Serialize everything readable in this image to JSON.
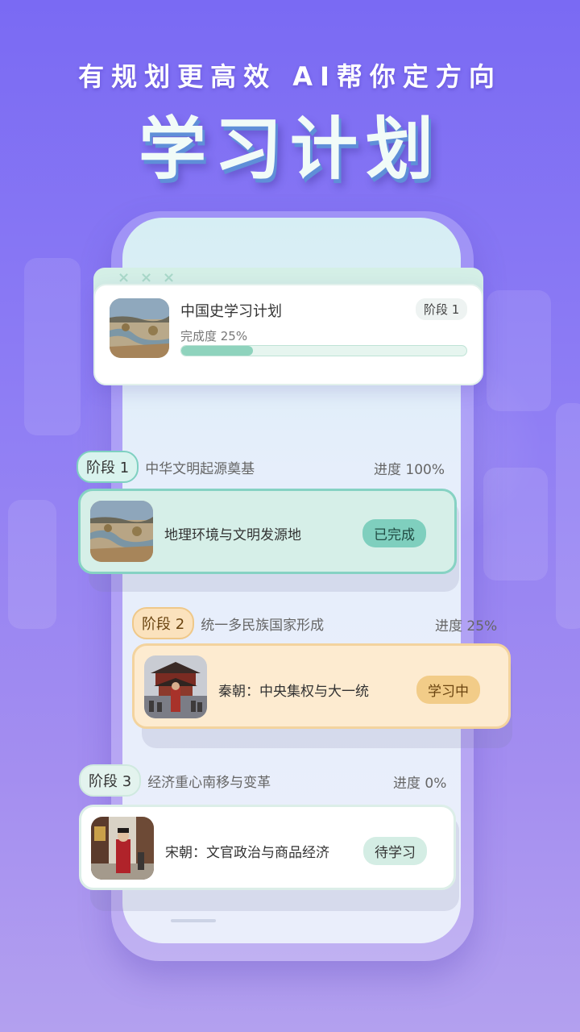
{
  "promo": {
    "tagline": "有规划更高效  AI帮你定方向",
    "headline": "学习计划"
  },
  "plan_card": {
    "title": "中国史学习计划",
    "stage_badge": "阶段 1",
    "progress_label": "完成度 25%",
    "progress": 0.25,
    "close_marks": [
      "×",
      "×",
      "×"
    ]
  },
  "stages": [
    {
      "badge": "阶段 1",
      "title": "中华文明起源奠基",
      "progress": "进度 100%",
      "lesson": {
        "title": "地理环境与文明发源地",
        "status": "已完成"
      }
    },
    {
      "badge": "阶段 2",
      "title": "统一多民族国家形成",
      "progress": "进度 25%",
      "lesson": {
        "title": "秦朝：中央集权与大一统",
        "status": "学习中"
      }
    },
    {
      "badge": "阶段 3",
      "title": "经济重心南移与变革",
      "progress": "进度 0%",
      "lesson": {
        "title": "宋朝：文官政治与商品经济",
        "status": "待学习"
      }
    }
  ],
  "colors": {
    "background": "#8f7ef4",
    "completed": "#7fcfbe",
    "in_progress": "#efc889",
    "pending": "#cfe9df"
  }
}
